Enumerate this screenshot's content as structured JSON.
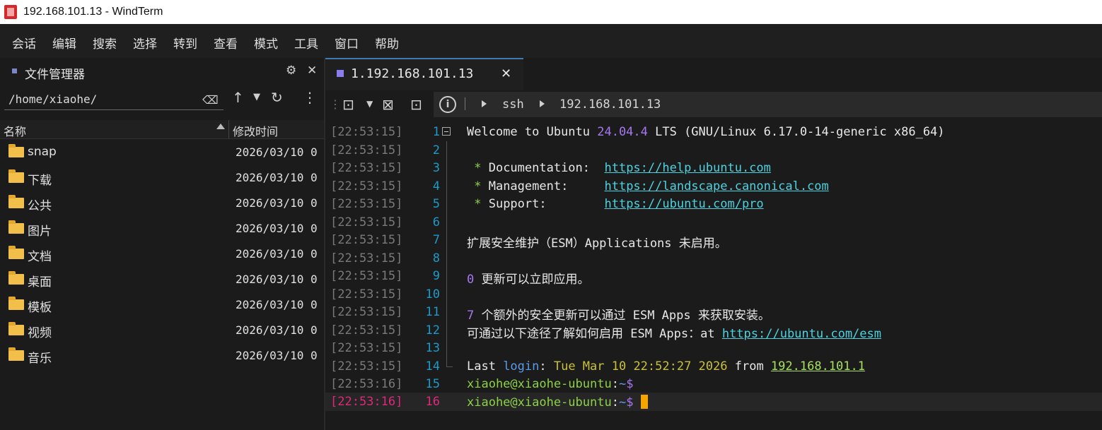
{
  "window": {
    "title": "192.168.101.13 - WindTerm"
  },
  "menu": [
    "会话",
    "编辑",
    "搜索",
    "选择",
    "转到",
    "查看",
    "模式",
    "工具",
    "窗口",
    "帮助"
  ],
  "file_manager": {
    "title": "文件管理器",
    "path": "/home/xiaohe/",
    "columns": {
      "name": "名称",
      "mtime": "修改时间"
    },
    "rows": [
      {
        "name": "snap",
        "mtime": "2026/03/10 0"
      },
      {
        "name": "下载",
        "mtime": "2026/03/10 0"
      },
      {
        "name": "公共",
        "mtime": "2026/03/10 0"
      },
      {
        "name": "图片",
        "mtime": "2026/03/10 0"
      },
      {
        "name": "文档",
        "mtime": "2026/03/10 0"
      },
      {
        "name": "桌面",
        "mtime": "2026/03/10 0"
      },
      {
        "name": "模板",
        "mtime": "2026/03/10 0"
      },
      {
        "name": "视频",
        "mtime": "2026/03/10 0"
      },
      {
        "name": "音乐",
        "mtime": "2026/03/10 0"
      }
    ]
  },
  "tab": {
    "label": "1.192.168.101.13",
    "close": "✕"
  },
  "breadcrumb": {
    "protocol": "ssh",
    "host": "192.168.101.13"
  },
  "terminal": {
    "lines": [
      {
        "ts": "[22:53:15]",
        "n": "1"
      },
      {
        "ts": "[22:53:15]",
        "n": "2"
      },
      {
        "ts": "[22:53:15]",
        "n": "3"
      },
      {
        "ts": "[22:53:15]",
        "n": "4"
      },
      {
        "ts": "[22:53:15]",
        "n": "5"
      },
      {
        "ts": "[22:53:15]",
        "n": "6"
      },
      {
        "ts": "[22:53:15]",
        "n": "7"
      },
      {
        "ts": "[22:53:15]",
        "n": "8"
      },
      {
        "ts": "[22:53:15]",
        "n": "9"
      },
      {
        "ts": "[22:53:15]",
        "n": "10"
      },
      {
        "ts": "[22:53:15]",
        "n": "11"
      },
      {
        "ts": "[22:53:15]",
        "n": "12"
      },
      {
        "ts": "[22:53:15]",
        "n": "13"
      },
      {
        "ts": "[22:53:15]",
        "n": "14"
      },
      {
        "ts": "[22:53:16]",
        "n": "15"
      },
      {
        "ts": "[22:53:16]",
        "n": "16"
      }
    ],
    "welcome": {
      "a": "Welcome to Ubuntu ",
      "ver": "24.04.4",
      "b": " LTS (GNU/Linux 6.17.0-14-generic x86_64)"
    },
    "doc": {
      "star": " * ",
      "label": "Documentation:  ",
      "url": "https://help.ubuntu.com"
    },
    "mgmt": {
      "star": " * ",
      "label": "Management:     ",
      "url": "https://landscape.canonical.com"
    },
    "support": {
      "star": " * ",
      "label": "Support:        ",
      "url": "https://ubuntu.com/pro"
    },
    "esm": "扩展安全维护（ESM）Applications 未启用。",
    "updates": {
      "n": "0",
      "text": " 更新可以立即应用。"
    },
    "esm_updates": {
      "n": "7",
      "text": " 个额外的安全更新可以通过 ESM Apps 来获取安装。"
    },
    "enable": {
      "text": "可通过以下途径了解如何启用 ESM Apps：at ",
      "url": "https://ubuntu.com/esm"
    },
    "lastlogin": {
      "a": "Last ",
      "b": "login",
      "c": ": ",
      "day": "Tue Mar 10 22:52:27 2026",
      "d": " from ",
      "ip": "192.168.101.1"
    },
    "prompt": {
      "user": "xiaohe@xiaohe-ubuntu",
      "colon": ":",
      "path": "~",
      "dollar": "$"
    }
  }
}
